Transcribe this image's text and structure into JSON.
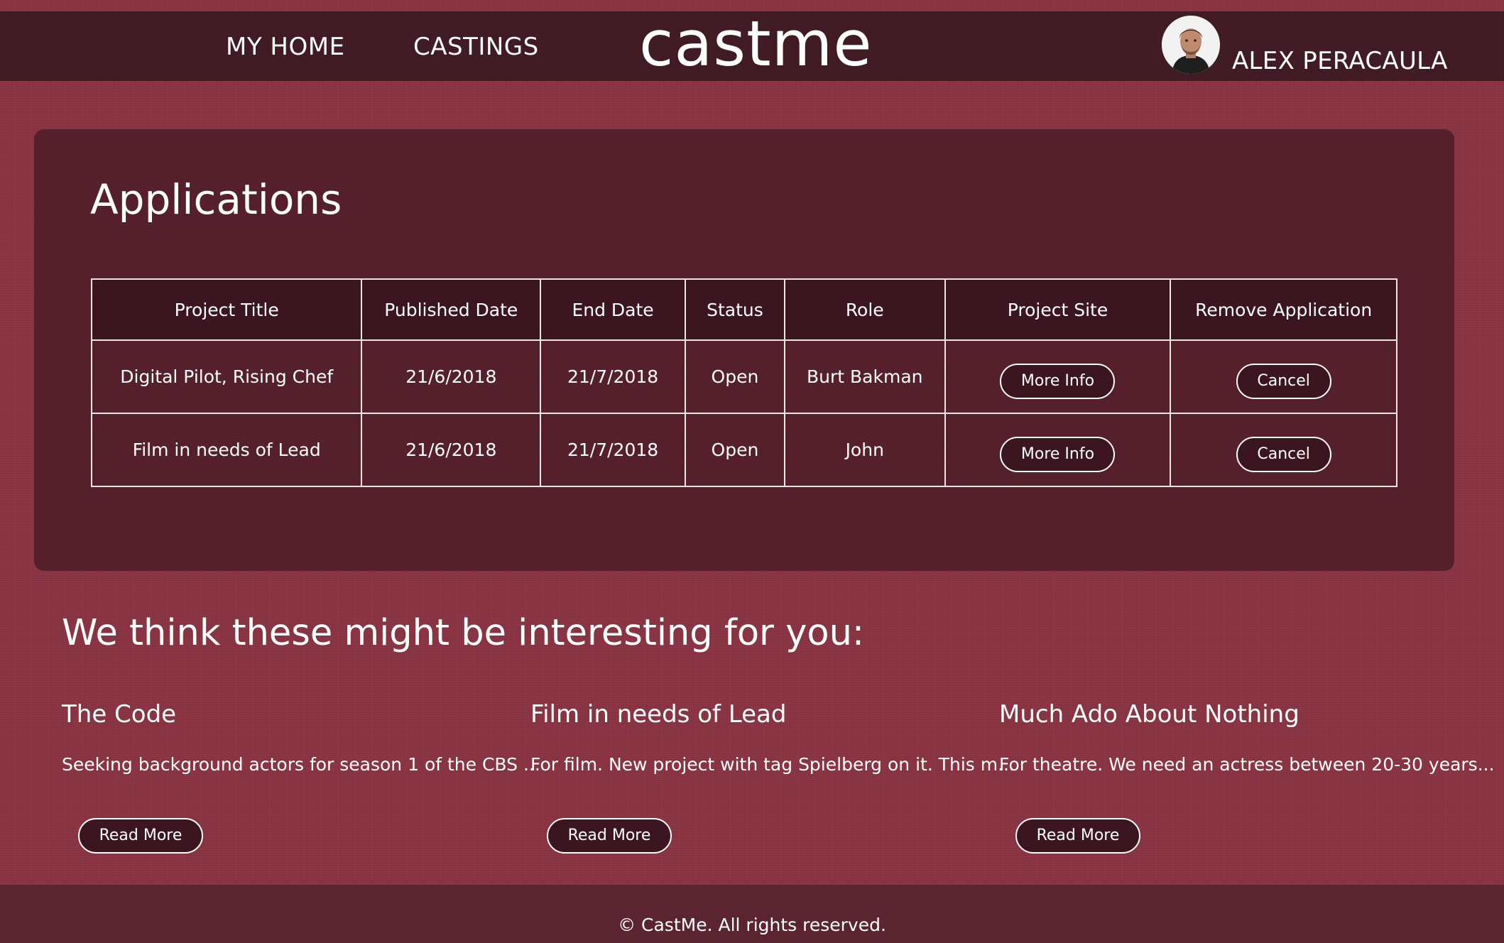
{
  "header": {
    "nav": {
      "home_label": "MY HOME",
      "castings_label": "CASTINGS"
    },
    "logo_text": "castme",
    "user": {
      "name": "ALEX PERACAULA",
      "avatar_icon": "user-avatar-photo"
    }
  },
  "applications": {
    "title": "Applications",
    "columns": {
      "project_title": "Project Title",
      "published_date": "Published Date",
      "end_date": "End Date",
      "status": "Status",
      "role": "Role",
      "project_site": "Project Site",
      "remove_application": "Remove Application"
    },
    "rows": [
      {
        "project_title": "Digital Pilot, Rising Chef",
        "published_date": "21/6/2018",
        "end_date": "21/7/2018",
        "status": "Open",
        "role": "Burt Bakman",
        "more_info_label": "More Info",
        "cancel_label": "Cancel"
      },
      {
        "project_title": "Film in needs of Lead",
        "published_date": "21/6/2018",
        "end_date": "21/7/2018",
        "status": "Open",
        "role": "John",
        "more_info_label": "More Info",
        "cancel_label": "Cancel"
      }
    ]
  },
  "suggestions": {
    "title": "We think these might be interesting for you:",
    "cards": [
      {
        "title": "The Code",
        "description": "Seeking background actors for season 1 of the CBS ...",
        "button_label": "Read More"
      },
      {
        "title": "Film in needs of Lead",
        "description": "For film. New project with tag Spielberg on it. This m...",
        "button_label": "Read More"
      },
      {
        "title": "Much Ado About Nothing",
        "description": "For theatre. We need an actress between 20-30 years...",
        "button_label": "Read More"
      }
    ]
  },
  "footer": {
    "text": "© CastMe. All rights reserved."
  },
  "colors": {
    "page_background": "#8a3342",
    "header_background": "#3f1a22",
    "panel_background": "#56202d",
    "table_header_background": "#3b1620",
    "footer_background": "#5a2431",
    "text": "#ffffff"
  }
}
